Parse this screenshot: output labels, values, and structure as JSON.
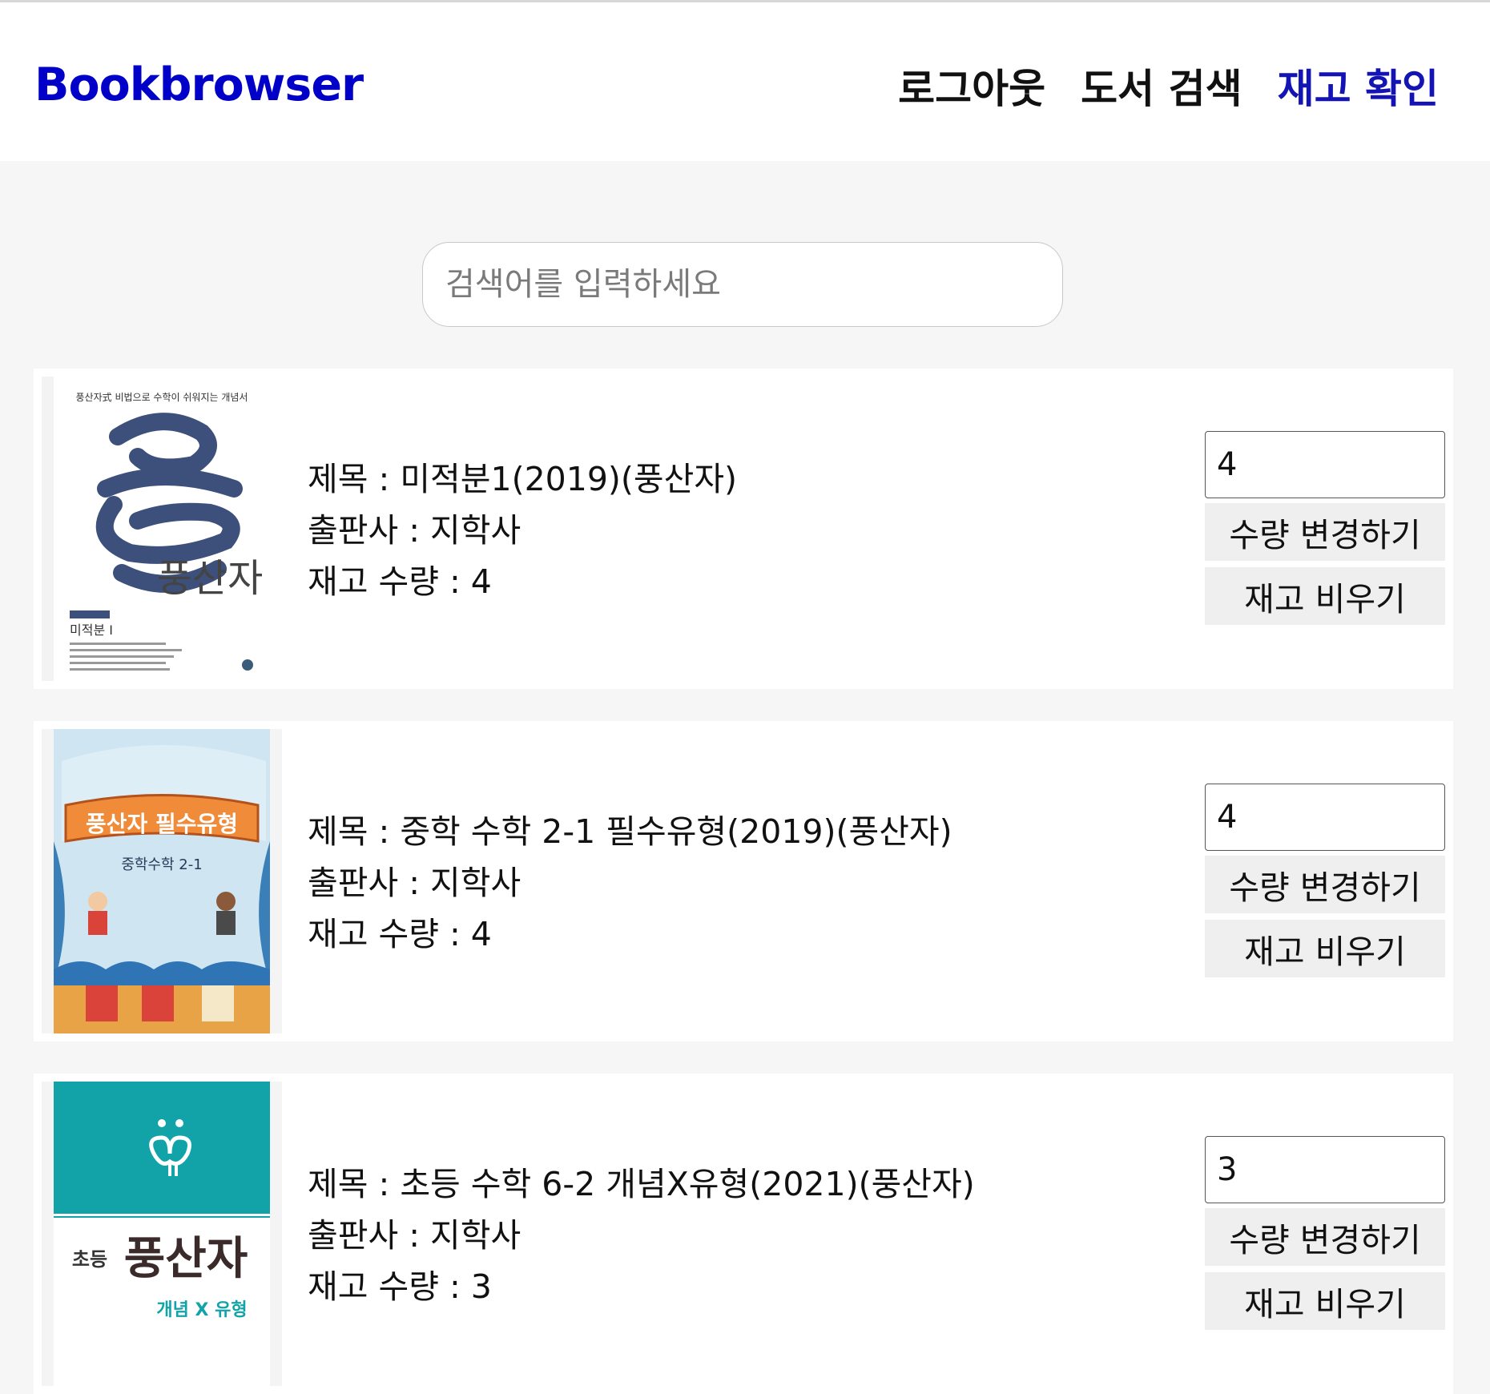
{
  "header": {
    "brand": "Bookbrowser",
    "nav": [
      {
        "label": "로그아웃"
      },
      {
        "label": "도서 검색"
      },
      {
        "label": "재고 확인"
      }
    ]
  },
  "search": {
    "placeholder": "검색어를 입력하세요",
    "value": ""
  },
  "labels": {
    "title": "제목 : ",
    "publisher": "출판사 : ",
    "stock": "재고 수량 : ",
    "change_button": "수량 변경하기",
    "clear_button": "재고 비우기"
  },
  "books": [
    {
      "title": "미적분1(2019)(풍산자)",
      "publisher": "지학사",
      "stock": "4",
      "qty": "4",
      "cover": {
        "heading": "풍산자式 비법으로 수학이 쉬워지는 개념서",
        "name": "풍산자",
        "sub": "미적분 I",
        "colors": [
          "#ffffff",
          "#3c4d78"
        ]
      }
    },
    {
      "title": "중학 수학 2-1 필수유형(2019)(풍산자)",
      "publisher": "지학사",
      "stock": "4",
      "qty": "4",
      "cover": {
        "name": "풍산자 필수유형",
        "sub": "중학수학 2-1",
        "colors": [
          "#e89a3a",
          "#5aa6d6"
        ]
      }
    },
    {
      "title": "초등 수학 6-2 개념X유형(2021)(풍산자)",
      "publisher": "지학사",
      "stock": "3",
      "qty": "3",
      "cover": {
        "name": "풍산자",
        "sub": "개념 X 유형",
        "prefix": "초등",
        "colors": [
          "#12a3a9",
          "#ffffff"
        ]
      }
    }
  ]
}
